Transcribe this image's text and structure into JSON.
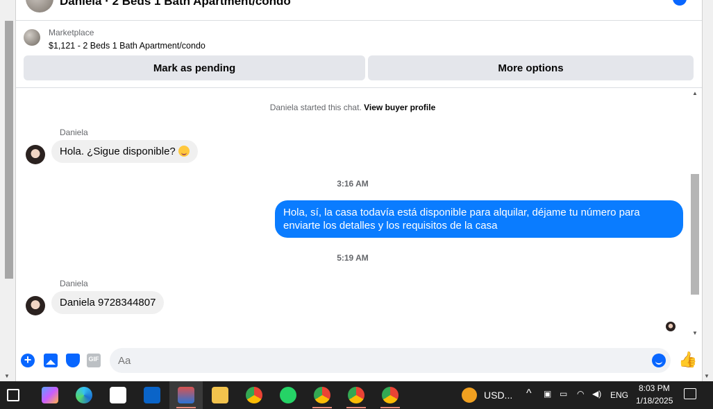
{
  "header": {
    "title": "Daniela · 2 Beds 1 Bath Apartment/condo"
  },
  "marketplace": {
    "label": "Marketplace",
    "listing": "$1,121 - 2 Beds 1 Bath Apartment/condo",
    "mark_pending": "Mark as pending",
    "more_options": "More options"
  },
  "chat": {
    "started_text": "Daniela started this chat.",
    "view_profile": "View buyer profile",
    "messages": [
      {
        "sender": "Daniela",
        "text": "Hola. ¿Sigue disponible?",
        "direction": "in"
      },
      {
        "time": "3:16 AM"
      },
      {
        "text": "Hola, sí, la casa todavía está disponible para alquilar, déjame tu número para enviarte los detalles y los requisitos de la casa",
        "direction": "out"
      },
      {
        "time": "5:19 AM"
      },
      {
        "sender": "Daniela",
        "text": "Daniela 9728344807",
        "direction": "in"
      }
    ]
  },
  "composer": {
    "placeholder": "Aa",
    "gif_label": "GIF"
  },
  "taskbar": {
    "stock": "USD...",
    "language": "ENG",
    "time": "8:03 PM",
    "date": "1/18/2025"
  },
  "colors": {
    "accent": "#0866ff",
    "outgoing_bubble": "#0a7cff",
    "incoming_bubble": "#f0f0f0",
    "taskbar": "#1f1f1f"
  }
}
